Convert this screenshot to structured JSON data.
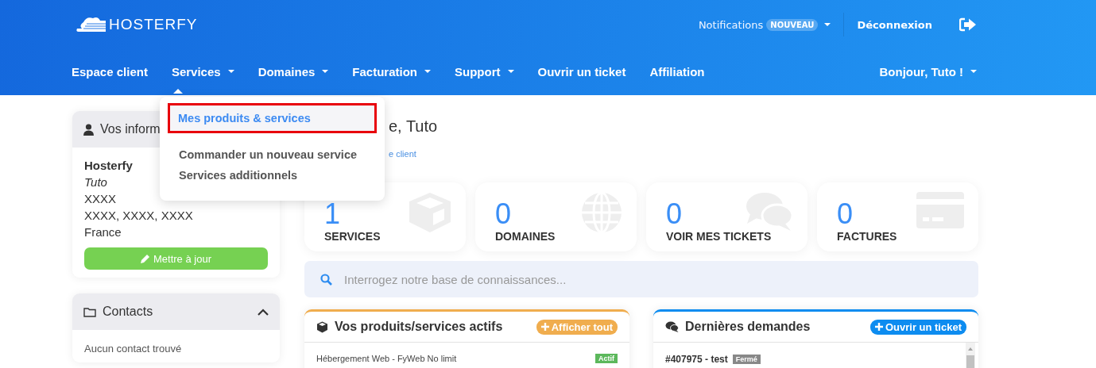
{
  "header": {
    "logo": "HOSTERFY",
    "notifications": {
      "label": "Notifications",
      "badge": "NOUVEAU"
    },
    "logout": "Déconnexion"
  },
  "nav": [
    {
      "label": "Espace client",
      "dropdown": false,
      "selected": false
    },
    {
      "label": "Services",
      "dropdown": true,
      "selected": true
    },
    {
      "label": "Domaines",
      "dropdown": true,
      "selected": false
    },
    {
      "label": "Facturation",
      "dropdown": true,
      "selected": false
    },
    {
      "label": "Support",
      "dropdown": true,
      "selected": false
    },
    {
      "label": "Ouvrir un ticket",
      "dropdown": false,
      "selected": false
    },
    {
      "label": "Affiliation",
      "dropdown": false,
      "selected": false
    }
  ],
  "greeting": "Bonjour, Tuto !",
  "services_menu": [
    {
      "label": "Mes produits & services",
      "selected": true
    },
    {
      "label": "Commander un nouveau service",
      "selected": false
    },
    {
      "label": "Services additionnels",
      "selected": false
    }
  ],
  "sidebar": {
    "info": {
      "title": "Vos inform",
      "lines": [
        "Hosterfy",
        "Tuto",
        "XXXX",
        "XXXX, XXXX, XXXX",
        "France"
      ],
      "button": "Mettre à jour"
    },
    "contacts": {
      "title": "Contacts",
      "expanded": true,
      "empty": "Aucun contact trouvé"
    }
  },
  "page": {
    "title": "e, Tuto",
    "breadcrumb": "e client"
  },
  "stats": [
    {
      "value": "1",
      "label": "SERVICES",
      "kind": "box"
    },
    {
      "value": "0",
      "label": "DOMAINES",
      "kind": "globe"
    },
    {
      "value": "0",
      "label": "VOIR MES TICKETS",
      "kind": "chat"
    },
    {
      "value": "0",
      "label": "FACTURES",
      "kind": "card"
    }
  ],
  "search": {
    "placeholder": "Interrogez notre base de connaissances..."
  },
  "panels": [
    {
      "kind": "services",
      "title": "Vos produits/services actifs",
      "button": "Afficher tout",
      "color": "#f0ad4e",
      "rows": [
        {
          "text": "Hébergement Web - FyWeb No limit",
          "status": "Actif",
          "color": "#5cb85c"
        }
      ]
    },
    {
      "kind": "tickets",
      "title": "Dernières demandes",
      "button": "Ouvrir un ticket",
      "color": "#0d8cf0",
      "rows": [
        {
          "text": "#407975 - test",
          "status": "Fermé",
          "color": "#888888"
        }
      ]
    }
  ]
}
